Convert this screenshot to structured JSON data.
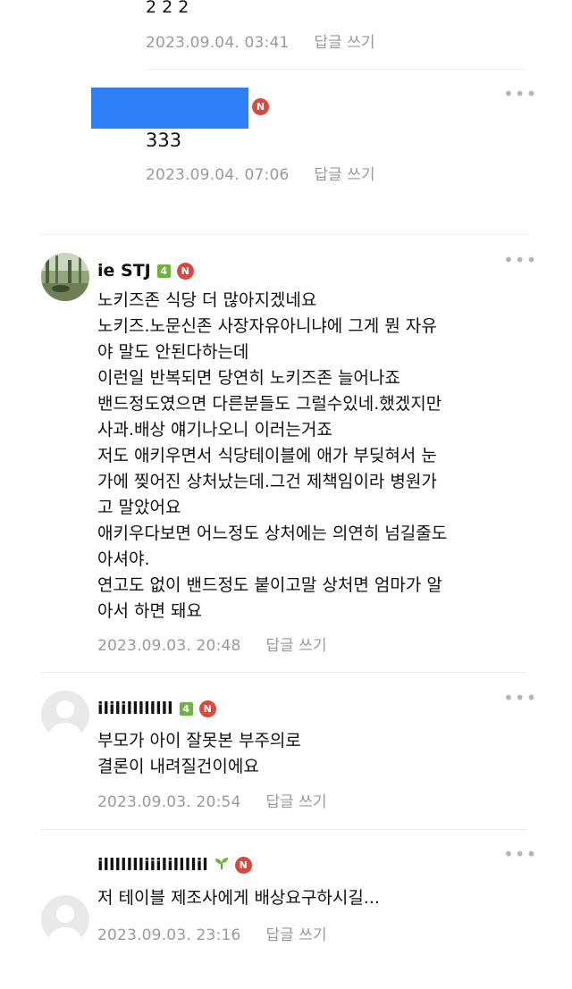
{
  "comments": [
    {
      "body_lines": [
        "2 2 2"
      ],
      "time": "2023.09.04. 03:41",
      "reply_label": "답글 쓰기"
    },
    {
      "body_lines": [
        "333"
      ],
      "time": "2023.09.04. 07:06",
      "reply_label": "답글 쓰기",
      "redacted_name_color": "#2d7ef7",
      "badge": "N"
    },
    {
      "nickname": "ie STJ",
      "level": "4",
      "badge": "N",
      "body_lines": [
        "노키즈존 식당 더 많아지겠네요",
        "노키즈.노문신존 사장자유아니냐에 그게 뭔 자유",
        "야 말도 안된다하는데",
        "이런일 반복되면 당연히 노키즈존 늘어나죠",
        "밴드정도였으면 다른분들도 그럴수있네.했겠지만",
        "사과.배상 얘기나오니 이러는거죠",
        "저도 애키우면서 식당테이블에 애가 부딪혀서 눈",
        "가에 찢어진 상처났는데.그건 제책임이라 병원가",
        "고 말았어요",
        "애키우다보면 어느정도 상처에는 의연히 넘길줄도",
        "아셔야.",
        "연고도 없이 밴드정도 붙이고말 상처면 엄마가 알",
        "아서 하면 돼요"
      ],
      "time": "2023.09.03. 20:48",
      "reply_label": "답글 쓰기"
    },
    {
      "nickname": "ililillllllll",
      "level": "4",
      "badge": "N",
      "body_lines": [
        "부모가 아이 잘못본 부주의로",
        "결론이 내려질건이에요"
      ],
      "time": "2023.09.03. 20:54",
      "reply_label": "답글 쓰기"
    },
    {
      "nickname": "illllllliiilillllil",
      "level_icon": "sprout-icon",
      "badge": "N",
      "body_lines": [
        "저 테이블 제조사에게 배상요구하시길..."
      ],
      "time": "2023.09.03. 23:16",
      "reply_label": "답글 쓰기"
    }
  ],
  "more_label": "•••",
  "colors": {
    "badge_red": "#d8483f",
    "level_green": "#6fb33e",
    "meta_gray": "#9a9a9a"
  }
}
